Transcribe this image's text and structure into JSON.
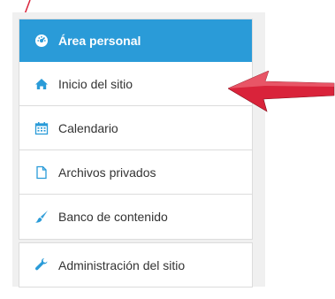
{
  "nav": {
    "items": [
      {
        "label": "Área personal",
        "icon": "dashboard-icon",
        "active": true
      },
      {
        "label": "Inicio del sitio",
        "icon": "home-icon"
      },
      {
        "label": "Calendario",
        "icon": "calendar-icon"
      },
      {
        "label": "Archivos privados",
        "icon": "file-icon"
      },
      {
        "label": "Banco de contenido",
        "icon": "paintbrush-icon"
      }
    ],
    "admin": {
      "label": "Administración del sitio",
      "icon": "wrench-icon"
    }
  },
  "colors": {
    "accent": "#2a9bd8",
    "arrow": "#d9233a",
    "icon": "#2a9bd8"
  }
}
